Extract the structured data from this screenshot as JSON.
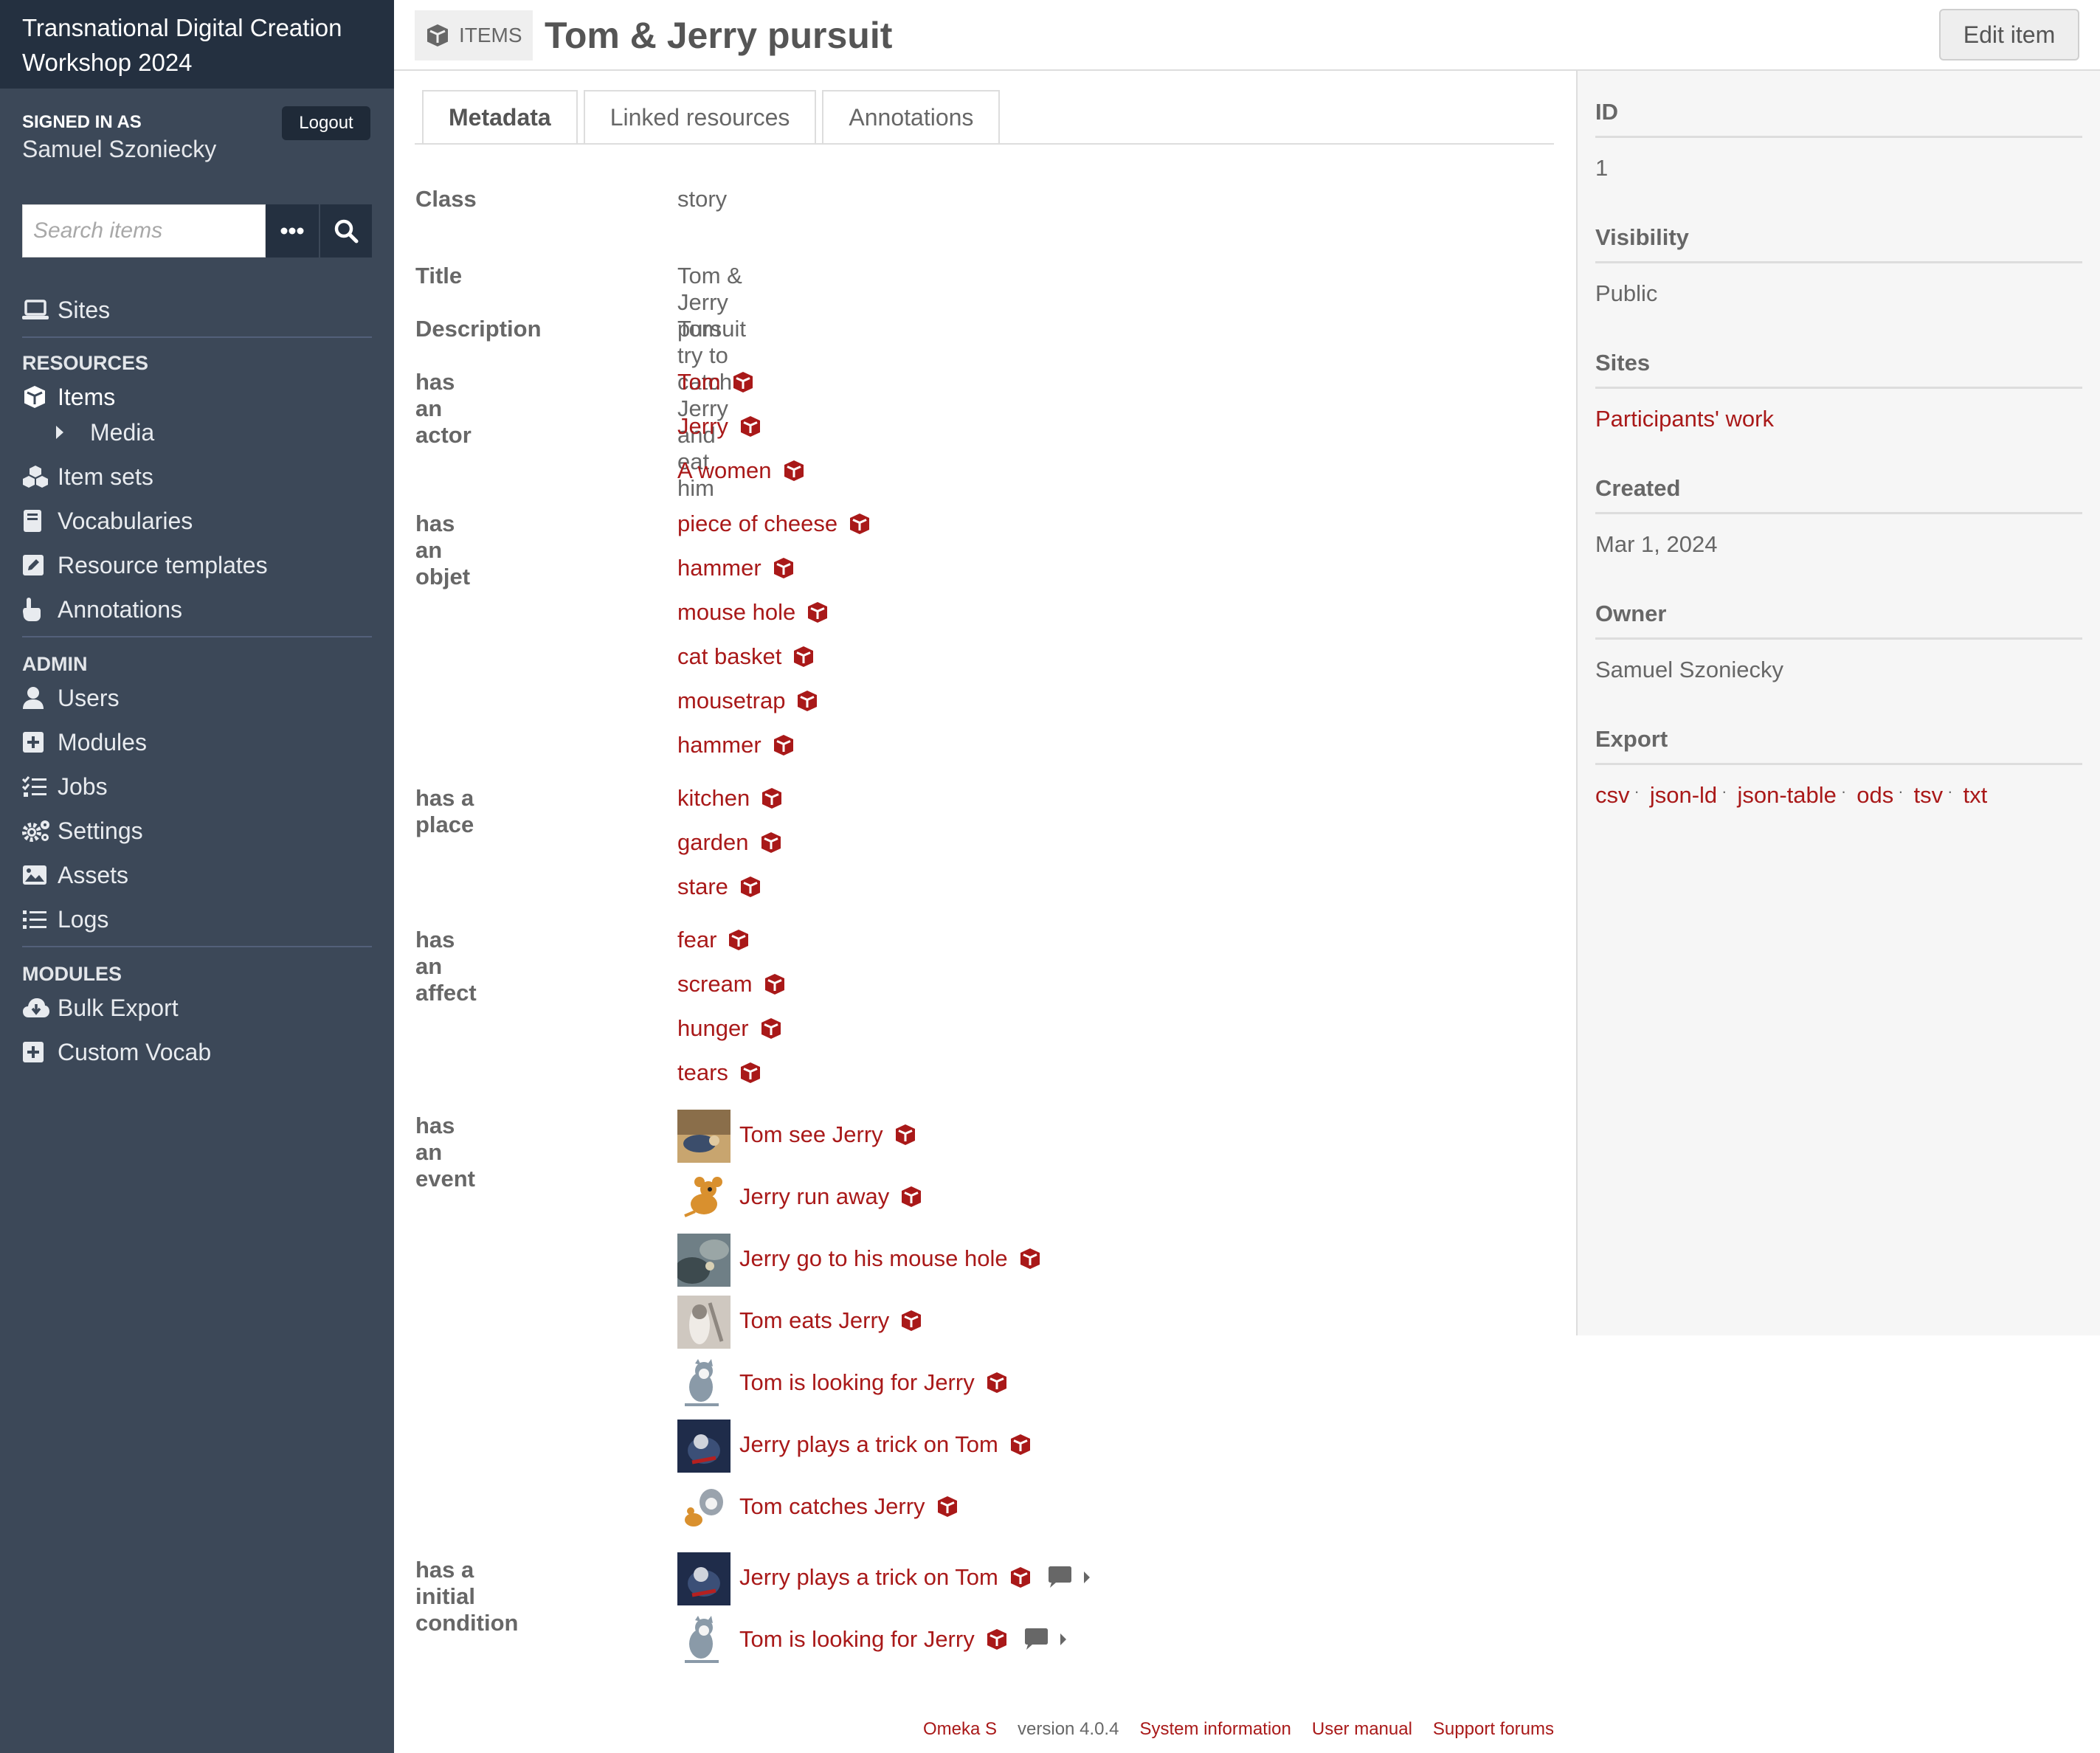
{
  "sidebar": {
    "install_title": "Transnational Digital Creation Workshop 2024",
    "signed_in_label": "SIGNED IN AS",
    "user_name": "Samuel Szoniecky",
    "logout_label": "Logout",
    "search_placeholder": "Search items",
    "sites_label": "Sites",
    "resources_header": "RESOURCES",
    "resources": [
      {
        "label": "Items",
        "icon": "cube-icon"
      },
      {
        "label": "Media",
        "icon": "caret-right-icon"
      },
      {
        "label": "Item sets",
        "icon": "cubes-icon"
      },
      {
        "label": "Vocabularies",
        "icon": "book-icon"
      },
      {
        "label": "Resource templates",
        "icon": "edit-icon"
      },
      {
        "label": "Annotations",
        "icon": "hand-pointer-icon"
      }
    ],
    "admin_header": "ADMIN",
    "admin": [
      {
        "label": "Users",
        "icon": "user-icon"
      },
      {
        "label": "Modules",
        "icon": "plus-square-icon"
      },
      {
        "label": "Jobs",
        "icon": "tasks-icon"
      },
      {
        "label": "Settings",
        "icon": "cogs-icon"
      },
      {
        "label": "Assets",
        "icon": "image-icon"
      },
      {
        "label": "Logs",
        "icon": "list-icon"
      }
    ],
    "modules_header": "MODULES",
    "modules": [
      {
        "label": "Bulk Export",
        "icon": "cloud-download-icon"
      },
      {
        "label": "Custom Vocab",
        "icon": "plus-square-icon"
      }
    ]
  },
  "header": {
    "resource_type": "ITEMS",
    "title": "Tom & Jerry pursuit",
    "edit_label": "Edit item"
  },
  "tabs": [
    "Metadata",
    "Linked resources",
    "Annotations"
  ],
  "metadata": {
    "class_label": "Class",
    "class_value": "story",
    "title_label": "Title",
    "title_value": "Tom & Jerry pursuit",
    "description_label": "Description",
    "description_value": "Tom try to catch Jerry and eat him",
    "actor_label": "has an actor",
    "actors": [
      "Tom",
      "Jerry",
      "A women"
    ],
    "objet_label": "has an objet",
    "objets": [
      "piece of cheese",
      "hammer",
      "mouse hole",
      "cat basket",
      "mousetrap",
      "hammer"
    ],
    "place_label": "has a place",
    "places": [
      "kitchen",
      "garden",
      "stare"
    ],
    "affect_label": "has an affect",
    "affects": [
      "fear",
      "scream",
      "hunger",
      "tears"
    ],
    "event_label": "has an event",
    "events": [
      "Tom see Jerry",
      "Jerry run away",
      "Jerry go to his mouse hole",
      "Tom eats Jerry",
      "Tom is looking for Jerry",
      "Jerry plays a trick on Tom",
      "Tom catches Jerry"
    ],
    "initial_label": "has a initial condition",
    "initial_conditions": [
      "Jerry plays a trick on Tom",
      "Tom is looking for Jerry"
    ]
  },
  "panel": {
    "id_label": "ID",
    "id_value": "1",
    "visibility_label": "Visibility",
    "visibility_value": "Public",
    "sites_label": "Sites",
    "sites_value": "Participants' work",
    "created_label": "Created",
    "created_value": "Mar 1, 2024",
    "owner_label": "Owner",
    "owner_value": "Samuel Szoniecky",
    "export_label": "Export",
    "export_formats": [
      "csv",
      "json-ld",
      "json-table",
      "ods",
      "tsv",
      "txt"
    ]
  },
  "footer": {
    "omeka": "Omeka S",
    "version": "version 4.0.4",
    "system_info": "System information",
    "user_manual": "User manual",
    "support": "Support forums"
  },
  "colors": {
    "sidebar_bg": "#3c4858",
    "sidebar_top": "#243040",
    "link": "#a91919",
    "panel_bg": "#f6f6f6"
  }
}
